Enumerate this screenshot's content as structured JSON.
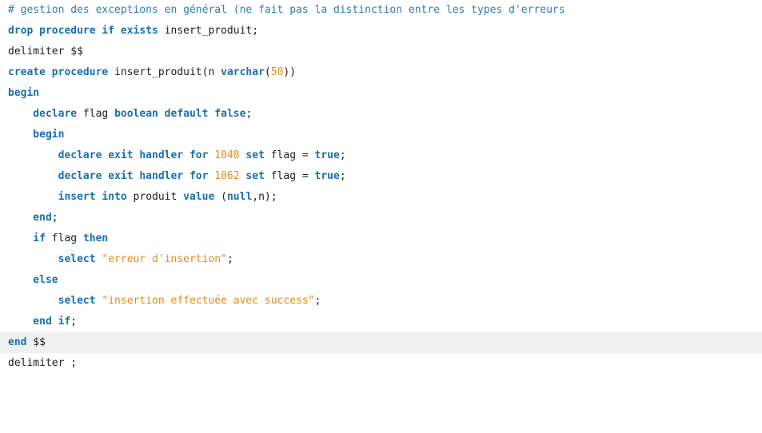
{
  "editor": {
    "language": "sql",
    "highlighted_line_index": 19,
    "colors": {
      "background": "#ffffff",
      "comment": "#2f7db5",
      "keyword": "#1a6fb0",
      "identifier": "#202020",
      "number": "#e58a1f",
      "string": "#e58a1f",
      "highlight_background": "#f0f0f0"
    },
    "lines": [
      {
        "text": "# gestion des exceptions en général (ne fait pas la distinction entre les types d'erreurs",
        "tokens": [
          {
            "t": "# gestion des exceptions en général (ne fait pas la distinction entre les types d'erreurs",
            "k": "comment"
          }
        ]
      },
      {
        "text": "drop procedure if exists insert_produit;",
        "tokens": [
          {
            "t": "drop procedure if exists",
            "k": "keyword"
          },
          {
            "t": " insert_produit;",
            "k": "ident"
          }
        ]
      },
      {
        "text": "delimiter $$",
        "tokens": [
          {
            "t": "delimiter $$",
            "k": "ident"
          }
        ]
      },
      {
        "text": "create procedure insert_produit(n varchar(50))",
        "tokens": [
          {
            "t": "create procedure",
            "k": "keyword"
          },
          {
            "t": " insert_produit(n ",
            "k": "ident"
          },
          {
            "t": "varchar",
            "k": "keyword"
          },
          {
            "t": "(",
            "k": "ident"
          },
          {
            "t": "50",
            "k": "number"
          },
          {
            "t": "))",
            "k": "ident"
          }
        ]
      },
      {
        "text": "begin",
        "tokens": [
          {
            "t": "begin",
            "k": "keyword"
          }
        ]
      },
      {
        "text": "    declare flag boolean default false;",
        "tokens": [
          {
            "t": "    declare",
            "k": "keyword"
          },
          {
            "t": " flag ",
            "k": "ident"
          },
          {
            "t": "boolean default false",
            "k": "keyword"
          },
          {
            "t": ";",
            "k": "ident"
          }
        ]
      },
      {
        "text": "    begin",
        "tokens": [
          {
            "t": "    begin",
            "k": "keyword"
          }
        ]
      },
      {
        "text": "        declare exit handler for 1048 set flag = true;",
        "tokens": [
          {
            "t": "        declare exit handler for",
            "k": "keyword"
          },
          {
            "t": " ",
            "k": "ident"
          },
          {
            "t": "1048",
            "k": "number"
          },
          {
            "t": " ",
            "k": "ident"
          },
          {
            "t": "set",
            "k": "keyword"
          },
          {
            "t": " flag = ",
            "k": "ident"
          },
          {
            "t": "true",
            "k": "keyword"
          },
          {
            "t": ";",
            "k": "ident"
          }
        ]
      },
      {
        "text": "        declare exit handler for 1062 set flag = true;",
        "tokens": [
          {
            "t": "        declare exit handler for",
            "k": "keyword"
          },
          {
            "t": " ",
            "k": "ident"
          },
          {
            "t": "1062",
            "k": "number"
          },
          {
            "t": " ",
            "k": "ident"
          },
          {
            "t": "set",
            "k": "keyword"
          },
          {
            "t": " flag = ",
            "k": "ident"
          },
          {
            "t": "true",
            "k": "keyword"
          },
          {
            "t": ";",
            "k": "ident"
          }
        ]
      },
      {
        "text": "        insert into produit value (null,n);",
        "tokens": [
          {
            "t": "        insert into",
            "k": "keyword"
          },
          {
            "t": " produit ",
            "k": "ident"
          },
          {
            "t": "value",
            "k": "keyword"
          },
          {
            "t": " (",
            "k": "ident"
          },
          {
            "t": "null",
            "k": "keyword"
          },
          {
            "t": ",n);",
            "k": "ident"
          }
        ]
      },
      {
        "text": "    end;",
        "tokens": [
          {
            "t": "    end",
            "k": "keyword"
          },
          {
            "t": ";",
            "k": "ident"
          }
        ]
      },
      {
        "text": "    if flag then",
        "tokens": [
          {
            "t": "    if",
            "k": "keyword"
          },
          {
            "t": " flag ",
            "k": "ident"
          },
          {
            "t": "then",
            "k": "keyword"
          }
        ]
      },
      {
        "text": "        select \"erreur d'insertion\";",
        "tokens": [
          {
            "t": "        select",
            "k": "keyword"
          },
          {
            "t": " ",
            "k": "ident"
          },
          {
            "t": "\"erreur d'insertion\"",
            "k": "string"
          },
          {
            "t": ";",
            "k": "ident"
          }
        ]
      },
      {
        "text": "    else",
        "tokens": [
          {
            "t": "    else",
            "k": "keyword"
          }
        ]
      },
      {
        "text": "        select \"insertion effectuée avec success\";",
        "tokens": [
          {
            "t": "        select",
            "k": "keyword"
          },
          {
            "t": " ",
            "k": "ident"
          },
          {
            "t": "\"insertion effectuée avec success\"",
            "k": "string"
          },
          {
            "t": ";",
            "k": "ident"
          }
        ]
      },
      {
        "text": "    end if;",
        "tokens": [
          {
            "t": "    end if",
            "k": "keyword"
          },
          {
            "t": ";",
            "k": "ident"
          }
        ]
      },
      {
        "text": "end $$",
        "tokens": [
          {
            "t": "end",
            "k": "keyword"
          },
          {
            "t": " $$",
            "k": "ident"
          }
        ]
      },
      {
        "text": "delimiter ;",
        "tokens": [
          {
            "t": "delimiter ;",
            "k": "ident"
          }
        ]
      }
    ]
  }
}
